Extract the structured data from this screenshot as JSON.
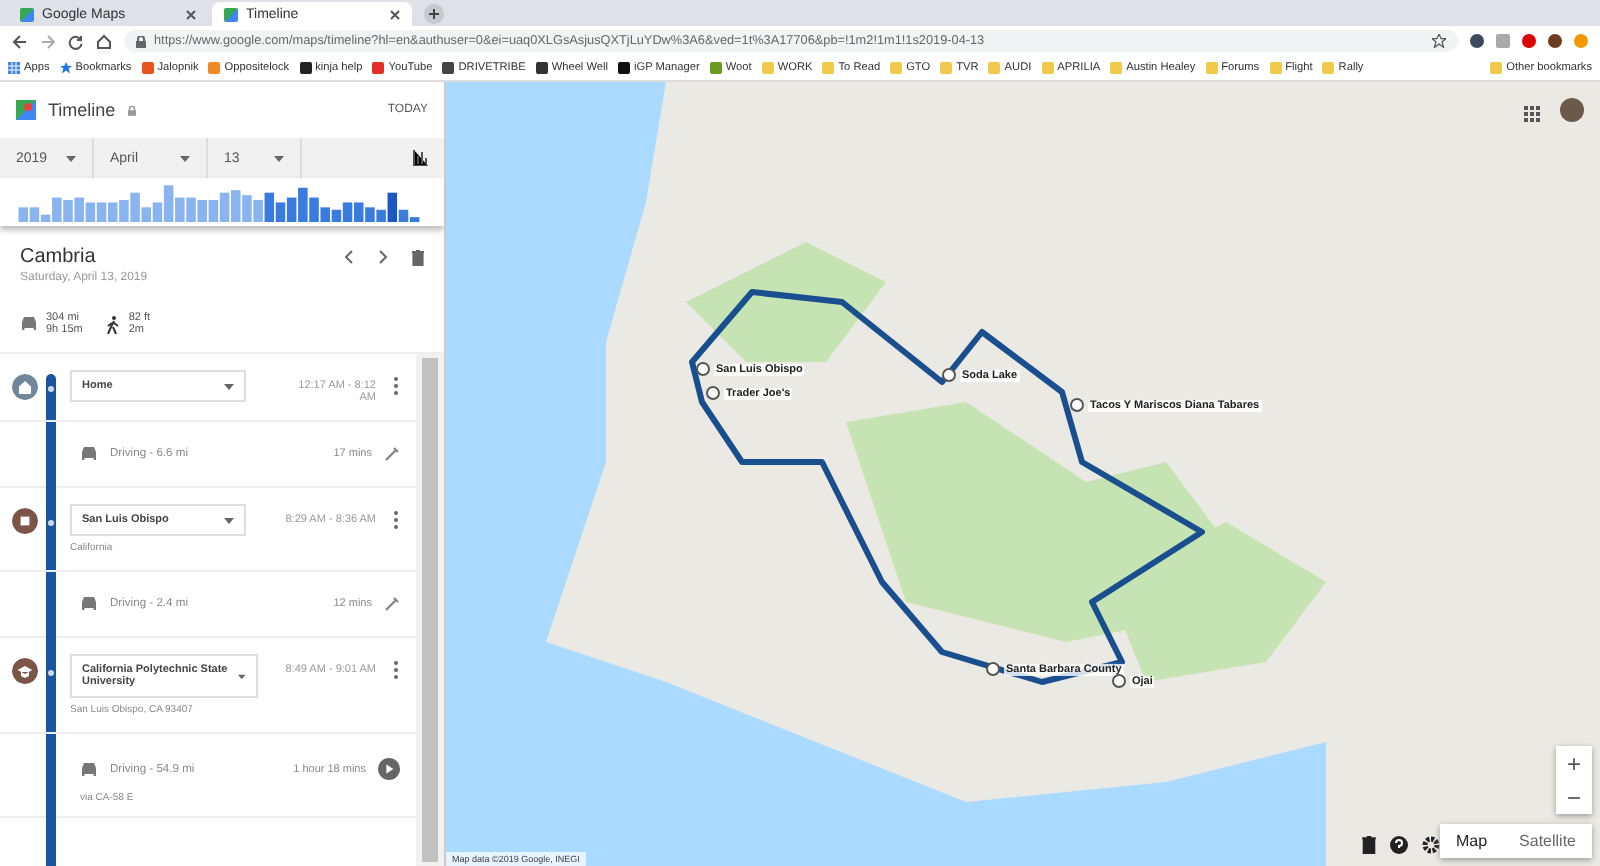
{
  "browser": {
    "tabs": [
      {
        "title": "Google Maps",
        "selected": false
      },
      {
        "title": "Timeline",
        "selected": true
      }
    ],
    "url": "https://www.google.com/maps/timeline?hl=en&authuser=0&ei=uaq0XLGsAsjusQXTjLuYDw%3A6&ved=1t%3A17706&pb=!1m2!1m1!1s2019-04-13",
    "bookmarks": [
      {
        "label": "Apps",
        "kind": "apps"
      },
      {
        "label": "Bookmarks",
        "kind": "star"
      },
      {
        "label": "Jalopnik",
        "kind": "site",
        "color": "#e8541c"
      },
      {
        "label": "Oppositelock",
        "kind": "site",
        "color": "#f08a24"
      },
      {
        "label": "kinja help",
        "kind": "site",
        "color": "#222222"
      },
      {
        "label": "YouTube",
        "kind": "site",
        "color": "#e52d27"
      },
      {
        "label": "DRIVETRIBE",
        "kind": "site",
        "color": "#444444"
      },
      {
        "label": "Wheel Well",
        "kind": "site",
        "color": "#333333"
      },
      {
        "label": "iGP Manager",
        "kind": "site",
        "color": "#111111"
      },
      {
        "label": "Woot",
        "kind": "site",
        "color": "#6a9a1f"
      },
      {
        "label": "WORK",
        "kind": "folder"
      },
      {
        "label": "To Read",
        "kind": "folder"
      },
      {
        "label": "GTO",
        "kind": "folder"
      },
      {
        "label": "TVR",
        "kind": "folder"
      },
      {
        "label": "AUDI",
        "kind": "folder"
      },
      {
        "label": "APRILIA",
        "kind": "folder"
      },
      {
        "label": "Austin Healey",
        "kind": "folder"
      },
      {
        "label": "Forums",
        "kind": "folder"
      },
      {
        "label": "Flight",
        "kind": "folder"
      },
      {
        "label": "Rally",
        "kind": "folder"
      }
    ],
    "other_bookmarks": "Other bookmarks"
  },
  "panel": {
    "title": "Timeline",
    "today": "TODAY",
    "year": "2019",
    "month": "April",
    "day": "13",
    "place": "Cambria",
    "date": "Saturday, April 13, 2019",
    "stats": [
      {
        "kind": "car",
        "distance": "304 mi",
        "duration": "9h 15m"
      },
      {
        "kind": "walk",
        "distance": "82 ft",
        "duration": "2m"
      }
    ],
    "entries": [
      {
        "kind": "home",
        "name": "Home",
        "time": "12:17 AM - 8:12 AM"
      },
      {
        "kind": "drive",
        "label": "Driving - 6.6 mi",
        "duration": "17 mins"
      },
      {
        "kind": "city",
        "name": "San Luis Obispo",
        "address": "California",
        "time": "8:29 AM - 8:36 AM"
      },
      {
        "kind": "drive",
        "label": "Driving - 2.4 mi",
        "duration": "12 mins"
      },
      {
        "kind": "school",
        "name": "California Polytechnic State University",
        "address": "San Luis Obispo, CA 93407",
        "time": "8:49 AM - 9:01 AM"
      },
      {
        "kind": "drive",
        "label": "Driving - 54.9 mi",
        "duration": "1 hour 18 mins",
        "via": "via CA-58 E"
      }
    ]
  },
  "map": {
    "pins": [
      {
        "label": "San Luis Obispo"
      },
      {
        "label": "Trader Joe's"
      },
      {
        "label": "Soda Lake"
      },
      {
        "label": "Tacos Y Mariscos Diana Tabares"
      },
      {
        "label": "Santa Barbara County"
      },
      {
        "label": "Ojai"
      }
    ],
    "attribution": "Map data ©2019 Google, INEGI",
    "types": [
      {
        "label": "Map",
        "selected": true
      },
      {
        "label": "Satellite",
        "selected": false
      }
    ],
    "zoom_in": "+",
    "zoom_out": "−"
  }
}
